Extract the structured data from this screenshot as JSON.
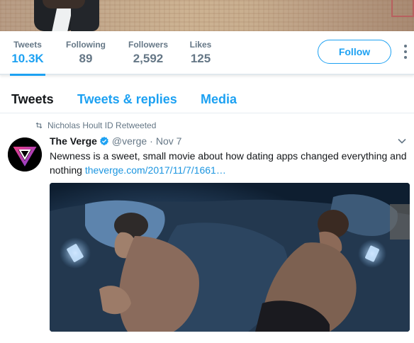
{
  "profile_nav": {
    "stats": [
      {
        "label": "Tweets",
        "value": "10.3K"
      },
      {
        "label": "Following",
        "value": "89"
      },
      {
        "label": "Followers",
        "value": "2,592"
      },
      {
        "label": "Likes",
        "value": "125"
      }
    ],
    "follow_label": "Follow"
  },
  "tabs": [
    {
      "label": "Tweets"
    },
    {
      "label": "Tweets & replies"
    },
    {
      "label": "Media"
    }
  ],
  "tweet": {
    "retweet_context": "Nicholas Hoult ID Retweeted",
    "author_name": "The Verge",
    "handle": "@verge",
    "separator": "·",
    "time": "Nov 7",
    "text": "Newness is a sweet, small movie about how dating apps changed everything and nothing ",
    "link": "theverge.com/2017/11/7/1661…"
  },
  "colors": {
    "accent": "#1da1f2",
    "link": "#1b95e0",
    "muted": "#657786",
    "text": "#14171a",
    "verge_logo_gradient": [
      "#e53f8b",
      "#8b3fd1"
    ]
  },
  "icons": [
    "retweet-icon",
    "verified-badge-icon",
    "chevron-down-icon",
    "more-options-icon"
  ]
}
